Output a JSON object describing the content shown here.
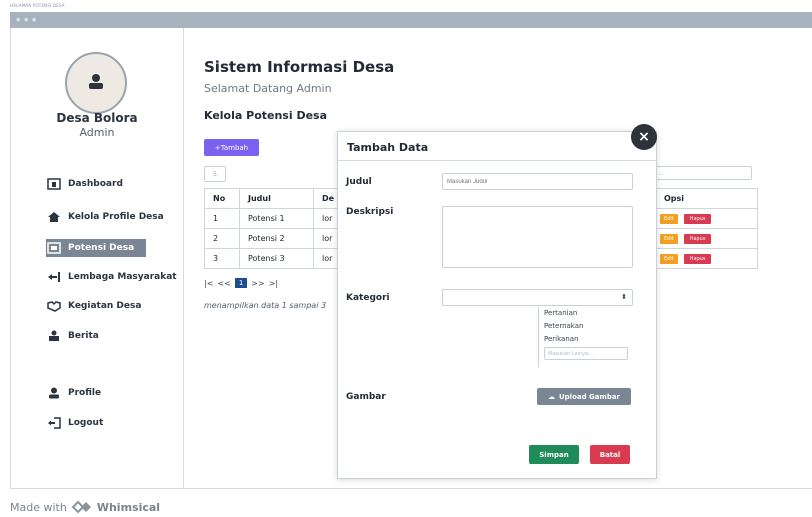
{
  "page_caption": "HALAMAN POTENSI DESA",
  "sidebar": {
    "village_name": "Desa Bolora",
    "role": "Admin",
    "items": [
      {
        "label": "Dashboard",
        "icon": "dashboard-icon"
      },
      {
        "label": "Kelola Profile Desa",
        "icon": "home-icon"
      },
      {
        "label": "Potensi Desa",
        "icon": "potensi-icon"
      },
      {
        "label": "Lembaga Masyarakat",
        "icon": "logout-arrow-icon"
      },
      {
        "label": "Kegiatan Desa",
        "icon": "handshake-icon"
      },
      {
        "label": "Berita",
        "icon": "news-icon"
      },
      {
        "label": "Profile",
        "icon": "user-icon"
      },
      {
        "label": "Logout",
        "icon": "logout-icon"
      }
    ]
  },
  "main": {
    "title": "Sistem Informasi Desa",
    "subtitle": "Selamat Datang  Admin",
    "section": "Kelola Potensi Desa",
    "add_button": "+Tambah",
    "page_size_value": "5",
    "search_placeholder": "...",
    "table": {
      "headers": [
        "No",
        "Judul",
        "De"
      ],
      "rows": [
        [
          "1",
          "Potensi 1",
          "lor"
        ],
        [
          "2",
          "Potensi 2",
          "lor"
        ],
        [
          "3",
          "Potensi 3",
          "lor"
        ]
      ],
      "opsi_header": "Opsi",
      "edit_label": "Edit",
      "delete_label": "Hapus"
    },
    "pager": {
      "first": "|<",
      "prev": "<<",
      "current": "1",
      "next": ">>",
      "last": ">|"
    },
    "showing": "menampilkan data 1 sampai 3"
  },
  "modal": {
    "title": "Tambah Data",
    "close": "×",
    "fields": {
      "judul_label": "Judul",
      "judul_placeholder": "Masukan Judul",
      "deskripsi_label": "Deskripsi",
      "kategori_label": "Kategori",
      "kategori_options": [
        "Pertanian",
        "Peternakan",
        "Perikanan"
      ],
      "kategori_other_placeholder": "Masukan Lainya...",
      "gambar_label": "Gambar",
      "upload_label": "Upload Gambar"
    },
    "save": "Simpan",
    "cancel": "Batal"
  },
  "footer": {
    "text": "Made with",
    "brand": "Whimsical"
  }
}
